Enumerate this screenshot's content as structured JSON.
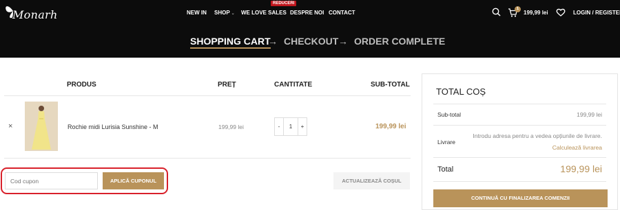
{
  "header": {
    "logo_text": "Monarh",
    "nav": [
      {
        "label": "NEW IN"
      },
      {
        "label": "SHOP"
      },
      {
        "label": "WE LOVE SALES",
        "badge": "REDUCERI"
      },
      {
        "label": "DESPRE NOI"
      },
      {
        "label": "CONTACT"
      }
    ],
    "cart_count": "1",
    "cart_total": "199,99 lei",
    "login": "LOGIN / REGISTER"
  },
  "steps": {
    "cart": "SHOPPING CART",
    "checkout": "CHECKOUT",
    "complete": "ORDER COMPLETE",
    "arrow": "→"
  },
  "table": {
    "headers": {
      "product": "PRODUS",
      "price": "PREȚ",
      "qty": "CANTITATE",
      "subtotal": "SUB-TOTAL"
    },
    "item": {
      "remove": "×",
      "name": "Rochie midi Lurisia Sunshine - M",
      "price": "199,99 lei",
      "qty": "1",
      "minus": "-",
      "plus": "+",
      "subtotal": "199,99 lei"
    }
  },
  "coupon": {
    "placeholder": "Cod cupon",
    "apply": "APLICĂ CUPONUL",
    "update": "ACTUALIZEAZĂ COȘUL"
  },
  "totals": {
    "title": "TOTAL COȘ",
    "subtotal_label": "Sub-total",
    "subtotal_value": "199,99 lei",
    "shipping_label": "Livrare",
    "shipping_note": "Introdu adresa pentru a vedea opțiunile de livrare.",
    "shipping_link": "Calculează livrarea",
    "total_label": "Total",
    "total_value": "199,99 lei",
    "checkout": "CONTINUĂ CU FINALIZAREA COMENZII"
  },
  "colors": {
    "accent": "#b9935a",
    "header_bg": "#0c0c0c",
    "highlight": "#d8202a"
  }
}
